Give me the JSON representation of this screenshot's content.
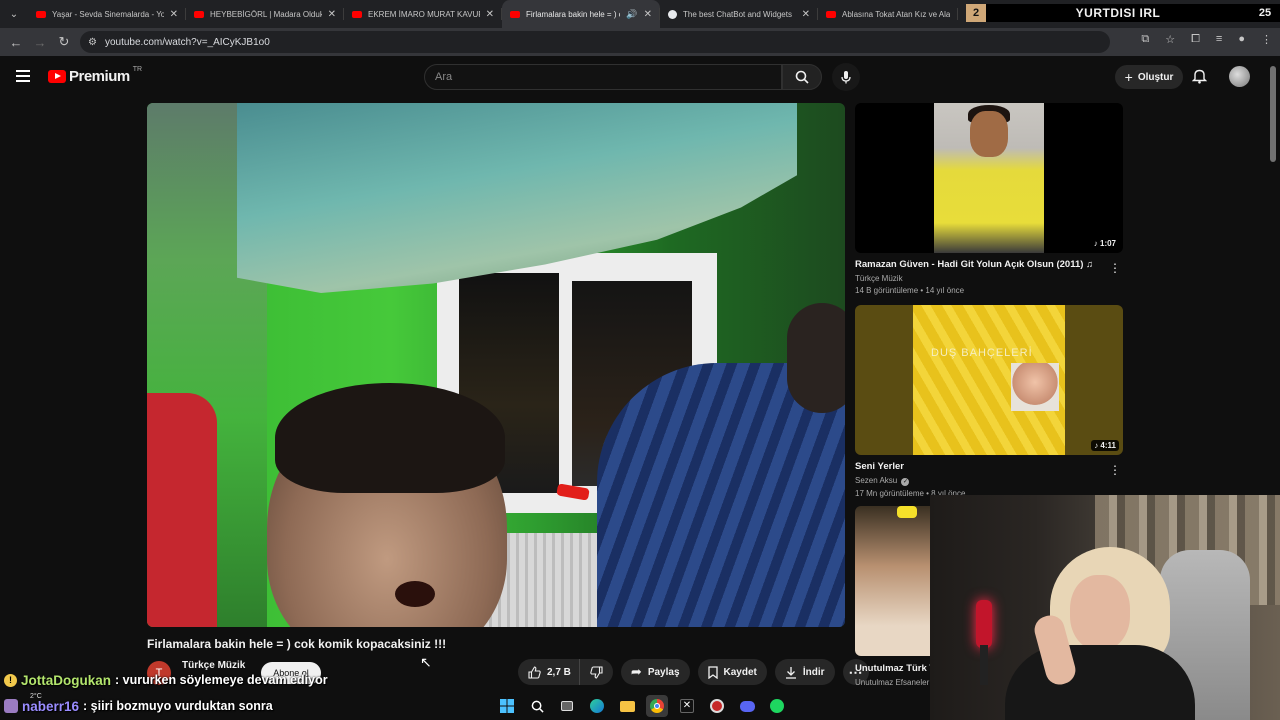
{
  "browser": {
    "tabs": [
      {
        "title": "Yaşar - Sevda Sinemalarda - Yo",
        "favicon": "youtube"
      },
      {
        "title": "HEYBEBİGÖRL | Madara Olduk",
        "favicon": "youtube"
      },
      {
        "title": "EKREM İMARO MURAT KAVUR",
        "favicon": "youtube"
      },
      {
        "title": "Firlamalara bakin hele = ) c",
        "favicon": "youtube",
        "active": true
      },
      {
        "title": "The best ChatBot and Widgets",
        "favicon": "chatbot"
      },
      {
        "title": "Ablasına Tokat Atan Kız ve Ala",
        "favicon": "youtube"
      }
    ],
    "url": "youtube.com/watch?v=_AICyKJB1o0"
  },
  "stream_overlay": {
    "badge": "2",
    "title": "YURTDISI IRL",
    "number": "25"
  },
  "youtube": {
    "logo_text": "Premium",
    "region": "TR",
    "search_placeholder": "Ara",
    "create_label": "Oluştur",
    "video": {
      "title": "Firlamalara bakin hele = ) cok komik kopacaksiniz !!!",
      "channel": "Türkçe Müzik",
      "channel_initial": "T",
      "subscribe_label": "Abone ol",
      "likes": "2,7 B",
      "share_label": "Paylaş",
      "save_label": "Kaydet",
      "download_label": "İndir"
    },
    "recommendations": [
      {
        "title": "Ramazan Güven - Hadi Git Yolun Açık Olsun (2011) ♫",
        "channel": "Türkçe Müzik",
        "meta": "14 B görüntüleme • 14 yıl önce",
        "duration": "♪ 1:07"
      },
      {
        "title": "Seni Yerler",
        "channel": "Sezen Aksu",
        "meta": "17 Mn görüntüleme • 8 yıl önce",
        "duration": "♪ 4:11",
        "cover_text": "DUŞ BAHÇELERİ"
      },
      {
        "title": "Unutulmaz Türk T",
        "channel": "Unutulmaz Efsaneler"
      }
    ]
  },
  "chat": [
    {
      "user": "JottaDogukan",
      "message": ": vururken söylemeye devam ediyor",
      "badge": "!",
      "color": "#b3e56d"
    },
    {
      "user": "naberr16",
      "message": ": şiiri bozmuyo vurduktan sonra",
      "color": "#9a8cff"
    }
  ],
  "taskbar": {
    "weather": "2°C",
    "icons": [
      "windows-icon",
      "search-icon",
      "task-view-icon",
      "edge-icon",
      "file-explorer-icon",
      "chrome-icon",
      "x-icon",
      "game-icon",
      "discord-icon",
      "spotify-icon"
    ]
  }
}
